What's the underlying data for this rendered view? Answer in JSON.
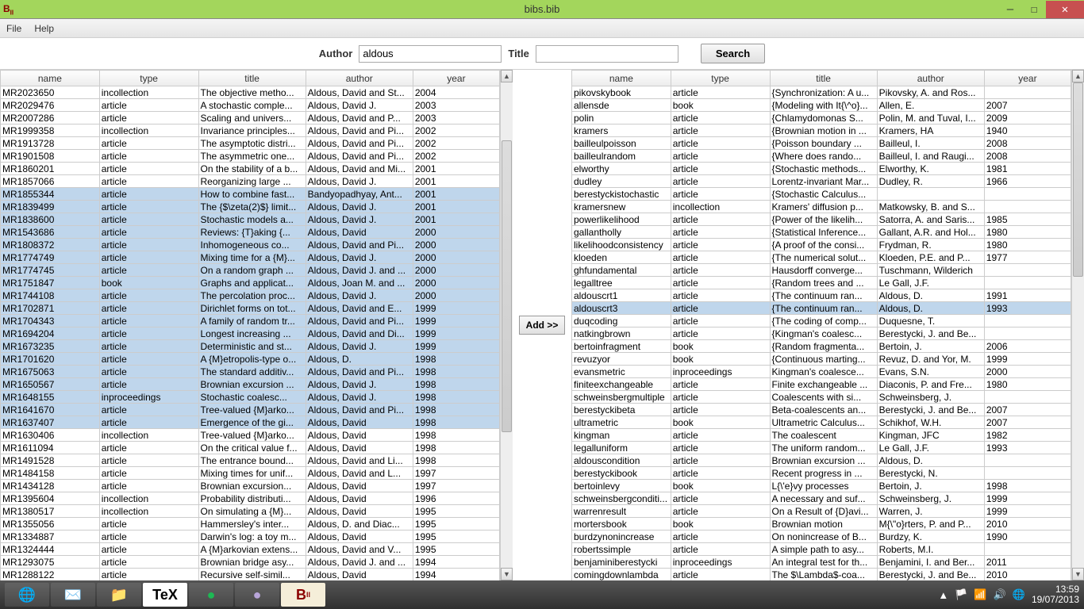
{
  "window": {
    "title": "bibs.bib"
  },
  "menu": {
    "file": "File",
    "help": "Help"
  },
  "search": {
    "lbl_author": "Author",
    "lbl_title": "Title",
    "val_author": "aldous",
    "val_title": "",
    "btn": "Search"
  },
  "middle": {
    "add": "Add >>"
  },
  "cols": {
    "name": "name",
    "type": "type",
    "title": "title",
    "author": "author",
    "year": "year"
  },
  "left_sel_start": 6,
  "left_sel_end": 22,
  "left": [
    {
      "name": "MR2023650",
      "type": "incollection",
      "title": "The objective metho...",
      "author": "Aldous, David and St...",
      "year": "2004"
    },
    {
      "name": "MR2029476",
      "type": "article",
      "title": "A stochastic comple...",
      "author": "Aldous, David J.",
      "year": "2003"
    },
    {
      "name": "MR2007286",
      "type": "article",
      "title": "Scaling and univers...",
      "author": "Aldous, David and P...",
      "year": "2003"
    },
    {
      "name": "MR1999358",
      "type": "incollection",
      "title": "Invariance principles...",
      "author": "Aldous, David and Pi...",
      "year": "2002"
    },
    {
      "name": "MR1913728",
      "type": "article",
      "title": "The asymptotic distri...",
      "author": "Aldous, David and Pi...",
      "year": "2002"
    },
    {
      "name": "MR1901508",
      "type": "article",
      "title": "The asymmetric one...",
      "author": "Aldous, David and Pi...",
      "year": "2002"
    },
    {
      "name": "MR1860201",
      "type": "article",
      "title": "On the stability of a b...",
      "author": "Aldous, David and Mi...",
      "year": "2001"
    },
    {
      "name": "MR1857066",
      "type": "article",
      "title": "Reorganizing large ...",
      "author": "Aldous, David J.",
      "year": "2001"
    },
    {
      "name": "MR1855344",
      "type": "article",
      "title": "How to combine fast...",
      "author": "Bandyopadhyay, Ant...",
      "year": "2001"
    },
    {
      "name": "MR1839499",
      "type": "article",
      "title": "The {$\\zeta(2)$} limit...",
      "author": "Aldous, David J.",
      "year": "2001"
    },
    {
      "name": "MR1838600",
      "type": "article",
      "title": "Stochastic models a...",
      "author": "Aldous, David J.",
      "year": "2001"
    },
    {
      "name": "MR1543686",
      "type": "article",
      "title": "Reviews: {T}aking {...",
      "author": "Aldous, David",
      "year": "2000"
    },
    {
      "name": "MR1808372",
      "type": "article",
      "title": "Inhomogeneous co...",
      "author": "Aldous, David and Pi...",
      "year": "2000"
    },
    {
      "name": "MR1774749",
      "type": "article",
      "title": "Mixing time for a {M}...",
      "author": "Aldous, David J.",
      "year": "2000"
    },
    {
      "name": "MR1774745",
      "type": "article",
      "title": "On a random graph ...",
      "author": "Aldous, David J. and ...",
      "year": "2000"
    },
    {
      "name": "MR1751847",
      "type": "book",
      "title": "Graphs and applicat...",
      "author": "Aldous, Joan M. and ...",
      "year": "2000"
    },
    {
      "name": "MR1744108",
      "type": "article",
      "title": "The percolation proc...",
      "author": "Aldous, David J.",
      "year": "2000"
    },
    {
      "name": "MR1702871",
      "type": "article",
      "title": "Dirichlet forms on tot...",
      "author": "Aldous, David and E...",
      "year": "1999"
    },
    {
      "name": "MR1704343",
      "type": "article",
      "title": "A family of random tr...",
      "author": "Aldous, David and Pi...",
      "year": "1999"
    },
    {
      "name": "MR1694204",
      "type": "article",
      "title": "Longest increasing ...",
      "author": "Aldous, David and Di...",
      "year": "1999"
    },
    {
      "name": "MR1673235",
      "type": "article",
      "title": "Deterministic and st...",
      "author": "Aldous, David J.",
      "year": "1999"
    },
    {
      "name": "MR1701620",
      "type": "article",
      "title": "A {M}etropolis-type o...",
      "author": "Aldous, D.",
      "year": "1998"
    },
    {
      "name": "MR1675063",
      "type": "article",
      "title": "The standard additiv...",
      "author": "Aldous, David and Pi...",
      "year": "1998"
    },
    {
      "name": "MR1650567",
      "type": "article",
      "title": "Brownian excursion ...",
      "author": "Aldous, David J.",
      "year": "1998"
    },
    {
      "name": "MR1648155",
      "type": "inproceedings",
      "title": "Stochastic coalesc...",
      "author": "Aldous, David J.",
      "year": "1998"
    },
    {
      "name": "MR1641670",
      "type": "article",
      "title": "Tree-valued {M}arko...",
      "author": "Aldous, David and Pi...",
      "year": "1998"
    },
    {
      "name": "MR1637407",
      "type": "article",
      "title": "Emergence of the gi...",
      "author": "Aldous, David",
      "year": "1998"
    },
    {
      "name": "MR1630406",
      "type": "incollection",
      "title": "Tree-valued {M}arko...",
      "author": "Aldous, David",
      "year": "1998"
    },
    {
      "name": "MR1611094",
      "type": "article",
      "title": "On the critical value f...",
      "author": "Aldous, David",
      "year": "1998"
    },
    {
      "name": "MR1491528",
      "type": "article",
      "title": "The entrance bound...",
      "author": "Aldous, David and Li...",
      "year": "1998"
    },
    {
      "name": "MR1484158",
      "type": "article",
      "title": "Mixing times for unif...",
      "author": "Aldous, David and L...",
      "year": "1997"
    },
    {
      "name": "MR1434128",
      "type": "article",
      "title": "Brownian excursion...",
      "author": "Aldous, David",
      "year": "1997"
    },
    {
      "name": "MR1395604",
      "type": "incollection",
      "title": "Probability distributi...",
      "author": "Aldous, David",
      "year": "1996"
    },
    {
      "name": "MR1380517",
      "type": "incollection",
      "title": "On simulating a {M}...",
      "author": "Aldous, David",
      "year": "1995"
    },
    {
      "name": "MR1355056",
      "type": "article",
      "title": "Hammersley's inter...",
      "author": "Aldous, D. and Diac...",
      "year": "1995"
    },
    {
      "name": "MR1334887",
      "type": "article",
      "title": "Darwin's log: a toy m...",
      "author": "Aldous, David",
      "year": "1995"
    },
    {
      "name": "MR1324444",
      "type": "article",
      "title": "A {M}arkovian extens...",
      "author": "Aldous, David and V...",
      "year": "1995"
    },
    {
      "name": "MR1293075",
      "type": "article",
      "title": "Brownian bridge asy...",
      "author": "Aldous, David J. and ...",
      "year": "1994"
    },
    {
      "name": "MR1288122",
      "type": "article",
      "title": "Recursive self-simil...",
      "author": "Aldous, David",
      "year": "1994"
    }
  ],
  "right_sel": [
    18
  ],
  "right": [
    {
      "name": "pikovskybook",
      "type": "article",
      "title": "{Synchronization: A u...",
      "author": "Pikovsky, A. and Ros...",
      "year": ""
    },
    {
      "name": "allensde",
      "type": "book",
      "title": "{Modeling with It{\\^o}...",
      "author": "Allen, E.",
      "year": "2007"
    },
    {
      "name": "polin",
      "type": "article",
      "title": "{Chlamydomonas S...",
      "author": "Polin, M. and Tuval, I...",
      "year": "2009"
    },
    {
      "name": "kramers",
      "type": "article",
      "title": "{Brownian motion in ...",
      "author": "Kramers, HA",
      "year": "1940"
    },
    {
      "name": "bailleulpoisson",
      "type": "article",
      "title": "{Poisson boundary ...",
      "author": "Bailleul, I.",
      "year": "2008"
    },
    {
      "name": "bailleulrandom",
      "type": "article",
      "title": "{Where does rando...",
      "author": "Bailleul, I. and Raugi...",
      "year": "2008"
    },
    {
      "name": "elworthy",
      "type": "article",
      "title": "{Stochastic methods...",
      "author": "Elworthy, K.",
      "year": "1981"
    },
    {
      "name": "dudley",
      "type": "article",
      "title": "Lorentz-invariant Mar...",
      "author": "Dudley, R.",
      "year": "1966"
    },
    {
      "name": "berestyckistochastic",
      "type": "article",
      "title": "{Stochastic Calculus...",
      "author": "",
      "year": ""
    },
    {
      "name": "kramersnew",
      "type": "incollection",
      "title": "Kramers' diffusion p...",
      "author": "Matkowsky, B. and S...",
      "year": ""
    },
    {
      "name": "powerlikelihood",
      "type": "article",
      "title": "{Power of the likelih...",
      "author": "Satorra, A. and Saris...",
      "year": "1985"
    },
    {
      "name": "gallantholly",
      "type": "article",
      "title": "{Statistical Inference...",
      "author": "Gallant, A.R. and Hol...",
      "year": "1980"
    },
    {
      "name": "likelihoodconsistency",
      "type": "article",
      "title": "{A proof of the consi...",
      "author": "Frydman, R.",
      "year": "1980"
    },
    {
      "name": "kloeden",
      "type": "article",
      "title": "{The numerical solut...",
      "author": "Kloeden, P.E. and P...",
      "year": "1977"
    },
    {
      "name": "ghfundamental",
      "type": "article",
      "title": "Hausdorff converge...",
      "author": "Tuschmann, Wilderich",
      "year": ""
    },
    {
      "name": "legalltree",
      "type": "article",
      "title": "{Random trees and ...",
      "author": "Le Gall, J.F.",
      "year": ""
    },
    {
      "name": "aldouscrt1",
      "type": "article",
      "title": "{The continuum ran...",
      "author": "Aldous, D.",
      "year": "1991"
    },
    {
      "name": "aldouscrt3",
      "type": "article",
      "title": "{The continuum ran...",
      "author": "Aldous, D.",
      "year": "1993"
    },
    {
      "name": "duqcoding",
      "type": "article",
      "title": "{The coding of comp...",
      "author": "Duquesne, T.",
      "year": ""
    },
    {
      "name": "natkingbrown",
      "type": "article",
      "title": "{Kingman's coalesc...",
      "author": "Berestycki, J. and Be...",
      "year": ""
    },
    {
      "name": "bertoinfragment",
      "type": "book",
      "title": "{Random fragmenta...",
      "author": "Bertoin, J.",
      "year": "2006"
    },
    {
      "name": "revuzyor",
      "type": "book",
      "title": "{Continuous marting...",
      "author": "Revuz, D. and Yor, M.",
      "year": "1999"
    },
    {
      "name": "evansmetric",
      "type": "inproceedings",
      "title": "Kingman's coalesce...",
      "author": "Evans, S.N.",
      "year": "2000"
    },
    {
      "name": "finiteexchangeable",
      "type": "article",
      "title": "Finite exchangeable ...",
      "author": "Diaconis, P. and Fre...",
      "year": "1980"
    },
    {
      "name": "schweinsbergmultiple",
      "type": "article",
      "title": "Coalescents with si...",
      "author": "Schweinsberg, J.",
      "year": ""
    },
    {
      "name": "berestyckibeta",
      "type": "article",
      "title": "Beta-coalescents an...",
      "author": "Berestycki, J. and Be...",
      "year": "2007"
    },
    {
      "name": "ultrametric",
      "type": "book",
      "title": "Ultrametric Calculus...",
      "author": "Schikhof, W.H.",
      "year": "2007"
    },
    {
      "name": "kingman",
      "type": "article",
      "title": "The coalescent",
      "author": "Kingman, JFC",
      "year": "1982"
    },
    {
      "name": "legalluniform",
      "type": "article",
      "title": "The uniform random...",
      "author": "Le Gall, J.F.",
      "year": "1993"
    },
    {
      "name": "aldouscondition",
      "type": "article",
      "title": "Brownian excursion ...",
      "author": "Aldous, D.",
      "year": ""
    },
    {
      "name": "berestyckibook",
      "type": "article",
      "title": "Recent progress in ...",
      "author": "Berestycki, N.",
      "year": ""
    },
    {
      "name": "bertoinlevy",
      "type": "book",
      "title": "L{\\'e}vy processes",
      "author": "Bertoin, J.",
      "year": "1998"
    },
    {
      "name": "schweinsbergconditi...",
      "type": "article",
      "title": "A necessary and suf...",
      "author": "Schweinsberg, J.",
      "year": "1999"
    },
    {
      "name": "warrenresult",
      "type": "article",
      "title": "On a Result of {D}avi...",
      "author": "Warren, J.",
      "year": "1999"
    },
    {
      "name": "mortersbook",
      "type": "book",
      "title": "Brownian motion",
      "author": "M{\\\"o}rters, P. and P...",
      "year": "2010"
    },
    {
      "name": "burdzynonincrease",
      "type": "article",
      "title": "On nonincrease of B...",
      "author": "Burdzy, K.",
      "year": "1990"
    },
    {
      "name": "robertssimple",
      "type": "article",
      "title": "A simple path to asy...",
      "author": "Roberts, M.I.",
      "year": ""
    },
    {
      "name": "benjaminiberestycki",
      "type": "inproceedings",
      "title": "An integral test for th...",
      "author": "Benjamini, I. and Ber...",
      "year": "2011"
    },
    {
      "name": "comingdownlambda",
      "type": "article",
      "title": "The $\\Lambda$-coa...",
      "author": "Berestycki, J. and Be...",
      "year": "2010"
    }
  ],
  "taskbar": {
    "time": "13:59",
    "date": "19/07/2013"
  }
}
